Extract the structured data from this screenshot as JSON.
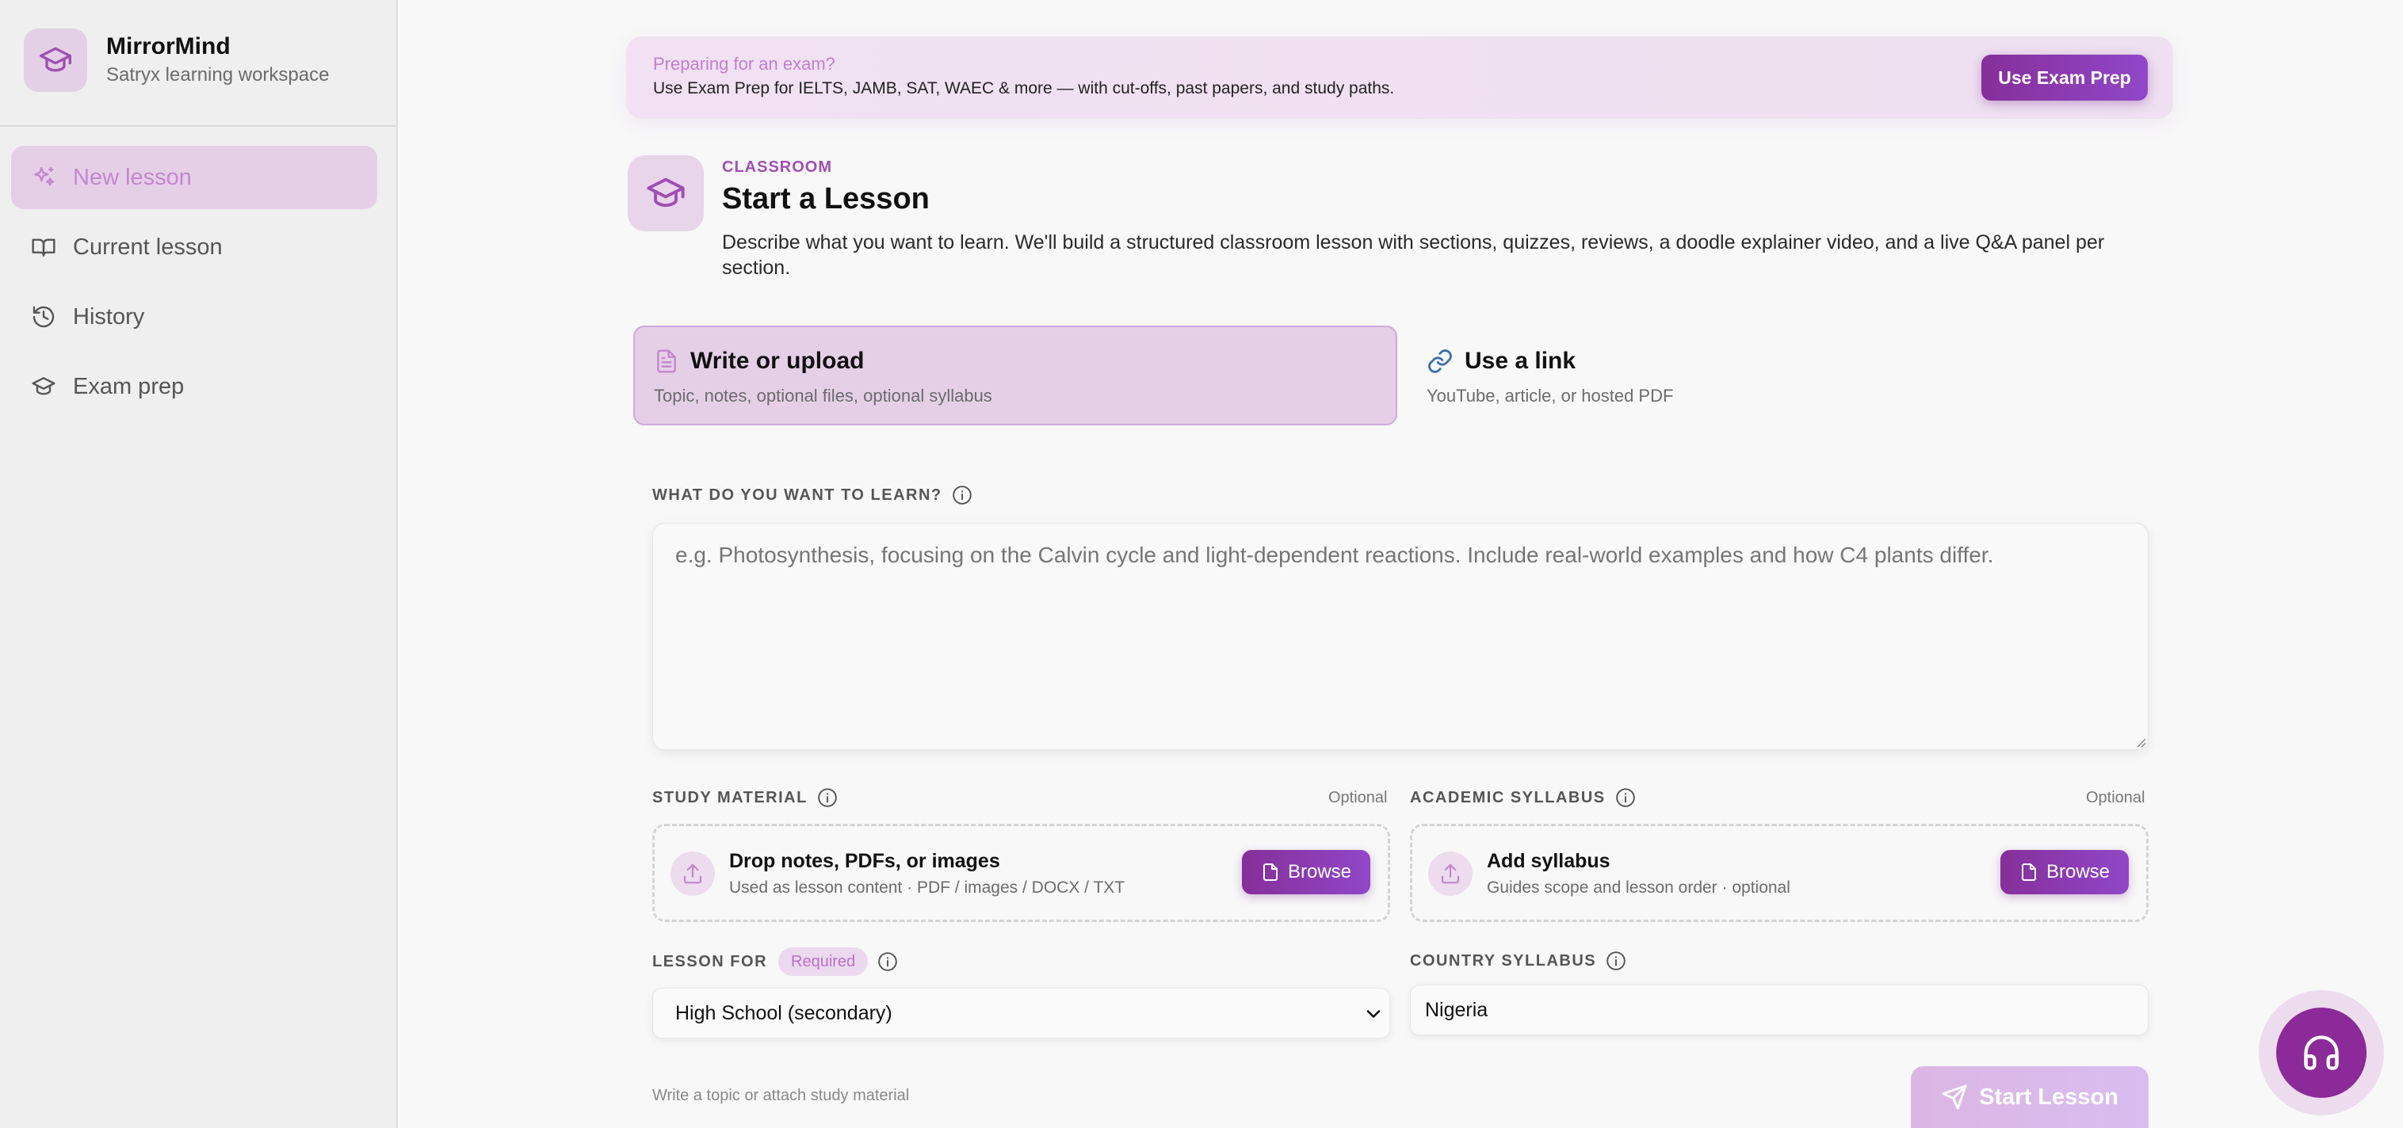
{
  "sidebar": {
    "brand_name": "MirrorMind",
    "brand_sub": "Satryx learning workspace",
    "items": [
      {
        "label": "New lesson",
        "icon": "sparkles-icon",
        "active": true
      },
      {
        "label": "Current lesson",
        "icon": "book-icon",
        "active": false
      },
      {
        "label": "History",
        "icon": "history-icon",
        "active": false
      },
      {
        "label": "Exam prep",
        "icon": "graduation-cap-icon",
        "active": false
      }
    ]
  },
  "banner": {
    "title": "Preparing for an exam?",
    "text": "Use Exam Prep for IELTS, JAMB, SAT, WAEC & more — with cut-offs, past papers, and study paths.",
    "button": "Use Exam Prep"
  },
  "header": {
    "eyebrow": "CLASSROOM",
    "title": "Start a Lesson",
    "description": "Describe what you want to learn. We'll build a structured classroom lesson with sections, quizzes, reviews, a doodle explainer video, and a live Q&A panel per section."
  },
  "modes": [
    {
      "title": "Write or upload",
      "sub": "Topic, notes, optional files, optional syllabus",
      "icon": "document-icon",
      "active": true
    },
    {
      "title": "Use a link",
      "sub": "YouTube, article, or hosted PDF",
      "icon": "link-icon",
      "active": false
    }
  ],
  "topic": {
    "label": "WHAT DO YOU WANT TO LEARN?",
    "placeholder": "e.g. Photosynthesis, focusing on the Calvin cycle and light-dependent reactions. Include real-world examples and how C4 plants differ."
  },
  "study_material": {
    "label": "STUDY MATERIAL",
    "optional": "Optional",
    "title": "Drop notes, PDFs, or images",
    "sub": "Used as lesson content · PDF / images / DOCX / TXT",
    "button": "Browse"
  },
  "academic_syllabus": {
    "label": "ACADEMIC SYLLABUS",
    "optional": "Optional",
    "title": "Add syllabus",
    "sub": "Guides scope and lesson order · optional",
    "button": "Browse"
  },
  "lesson_for": {
    "label": "LESSON FOR",
    "badge": "Required",
    "value": "High School (secondary)"
  },
  "country_syllabus": {
    "label": "COUNTRY SYLLABUS",
    "value": "Nigeria"
  },
  "footer": {
    "hint": "Write a topic or attach study material",
    "start_button": "Start Lesson"
  },
  "colors": {
    "accent": "#8b2a98",
    "accent_light": "#e5cfe7",
    "active_nav_text": "#c486d0"
  }
}
